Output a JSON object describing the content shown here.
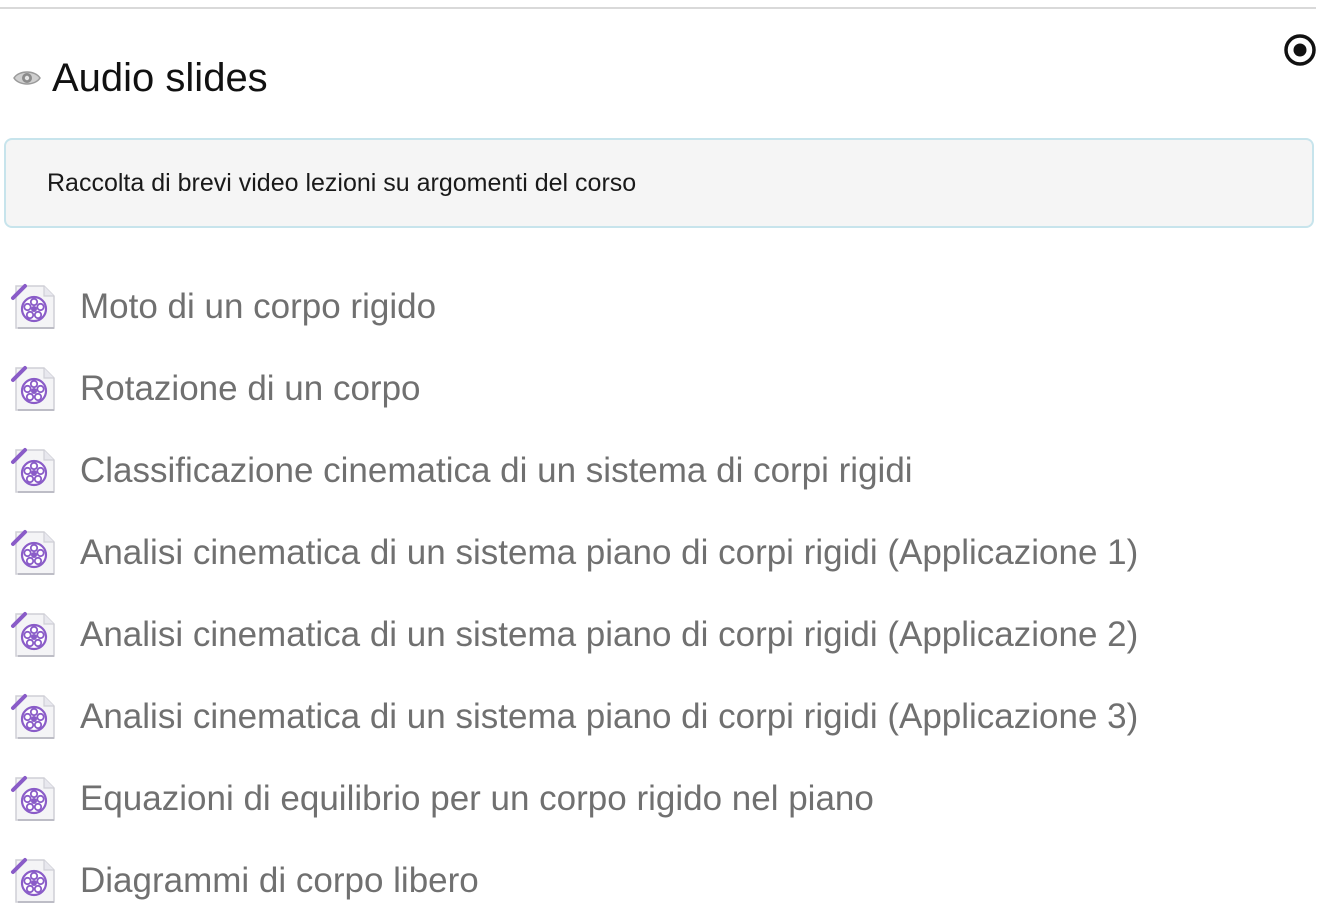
{
  "section": {
    "title": "Audio slides",
    "visibility_icon": "eye-icon",
    "completion_icon": "radio-completion-icon",
    "summary": "Raccolta di brevi video lezioni su argomenti del corso"
  },
  "activities": [
    {
      "label": "Moto di un corpo rigido",
      "icon": "video-file-icon"
    },
    {
      "label": "Rotazione di un corpo",
      "icon": "video-file-icon"
    },
    {
      "label": "Classificazione cinematica di un sistema di corpi rigidi",
      "icon": "video-file-icon"
    },
    {
      "label": "Analisi cinematica di un sistema piano di corpi rigidi (Applicazione 1)",
      "icon": "video-file-icon"
    },
    {
      "label": "Analisi cinematica di un sistema piano di corpi rigidi (Applicazione 2)",
      "icon": "video-file-icon"
    },
    {
      "label": "Analisi cinematica di un sistema piano di corpi rigidi (Applicazione 3)",
      "icon": "video-file-icon"
    },
    {
      "label": "Equazioni di equilibrio per un corpo rigido nel piano",
      "icon": "video-file-icon"
    },
    {
      "label": "Diagrammi di corpo libero",
      "icon": "video-file-icon"
    }
  ],
  "colors": {
    "summary_border": "#c7e4ec",
    "summary_background": "#f5f5f5",
    "activity_text": "#707070",
    "icon_accent": "#8a5cc8"
  }
}
